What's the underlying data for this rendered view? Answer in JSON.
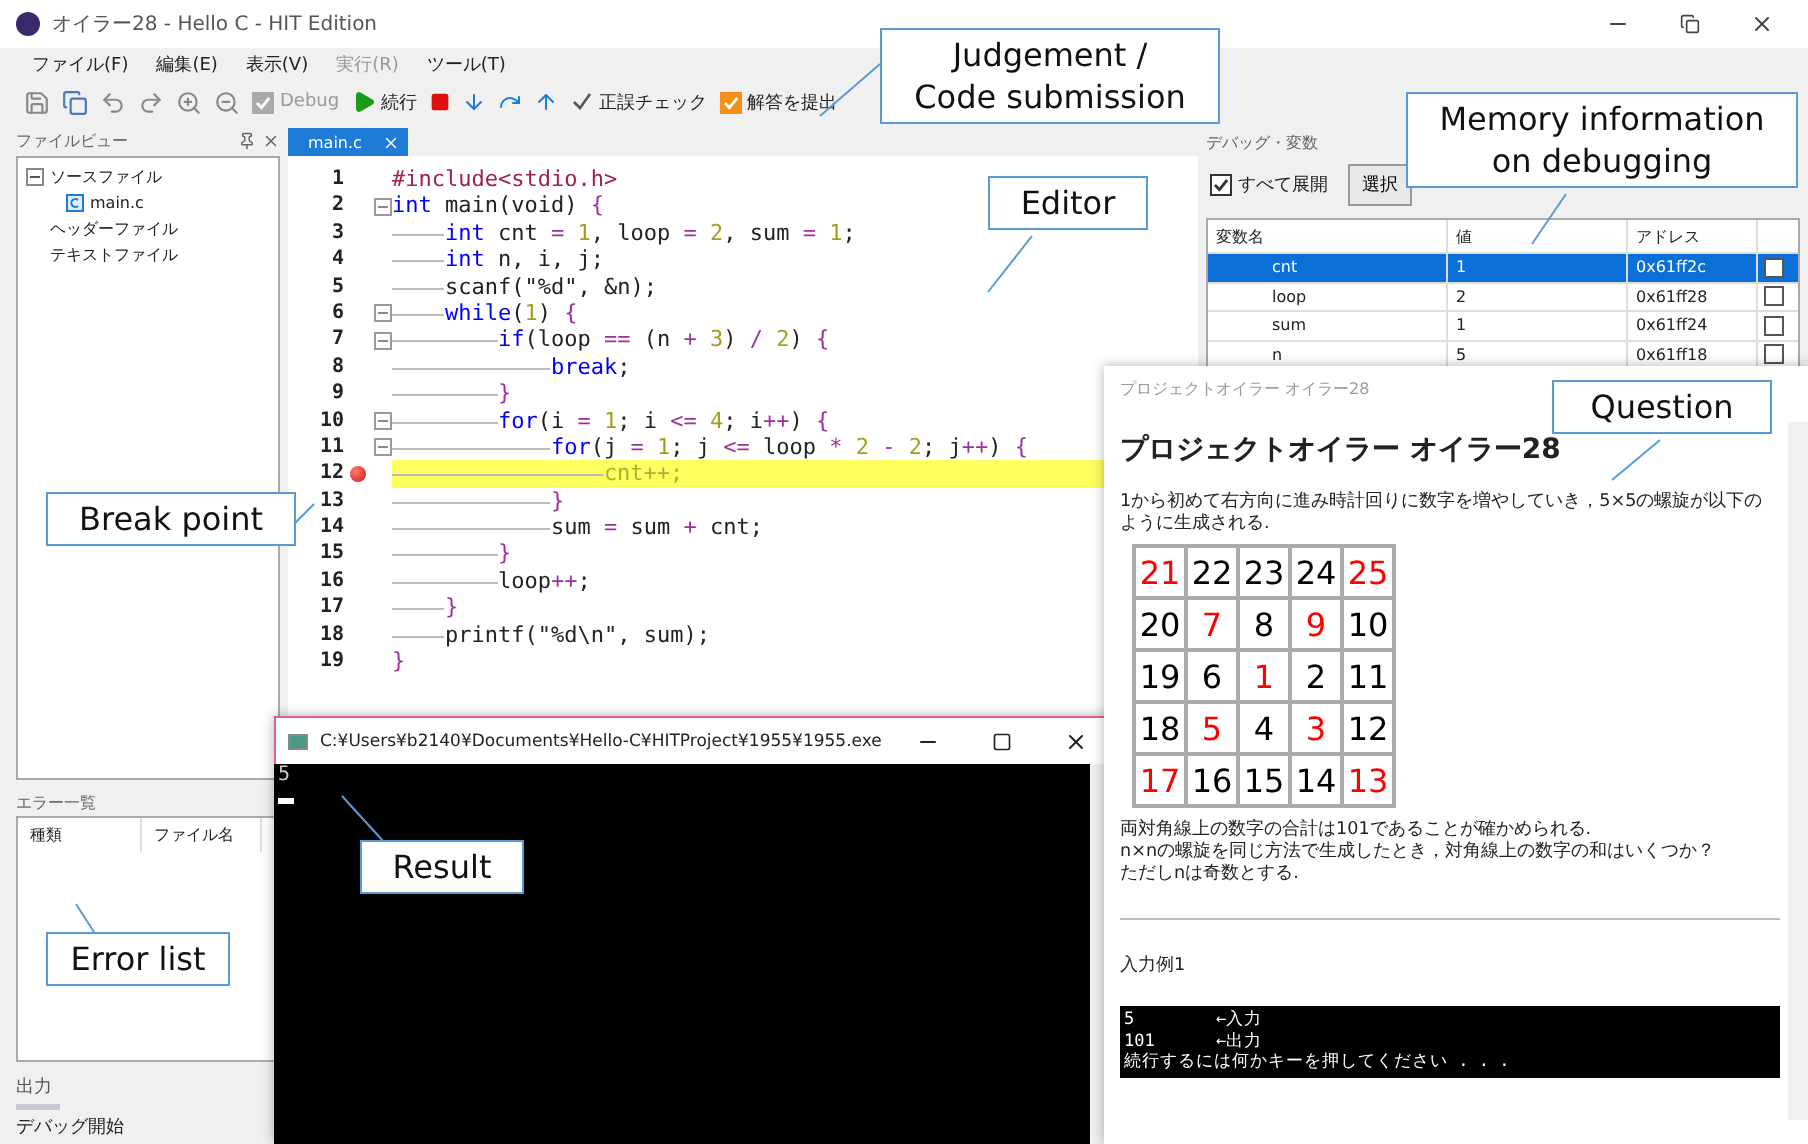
{
  "window": {
    "title": "オイラー28 - Hello C - HIT Edition"
  },
  "menu": [
    {
      "label": "ファイル(F)",
      "disabled": false
    },
    {
      "label": "編集(E)",
      "disabled": false
    },
    {
      "label": "表示(V)",
      "disabled": false
    },
    {
      "label": "実行(R)",
      "disabled": true
    },
    {
      "label": "ツール(T)",
      "disabled": false
    }
  ],
  "toolbar": {
    "debug": {
      "label": "Debug",
      "checked": true,
      "disabled": true
    },
    "continue": {
      "label": "続行"
    },
    "check": {
      "label": "正誤チェック"
    },
    "submit": {
      "label": "解答を提出",
      "checked": true
    }
  },
  "file_view": {
    "title": "ファイルビュー",
    "tree": [
      {
        "label": "ソースファイル",
        "expanded": true,
        "children": [
          {
            "label": "main.c"
          }
        ]
      },
      {
        "label": "ヘッダーファイル"
      },
      {
        "label": "テキストファイル"
      }
    ]
  },
  "error_list": {
    "title": "エラー一覧",
    "columns": [
      "種類",
      "ファイル名"
    ]
  },
  "output": {
    "title": "出力"
  },
  "status": "デバッグ開始",
  "editor": {
    "tab": "main.c",
    "lines": [
      {
        "num": "1",
        "fold": false,
        "breakpoint": false,
        "current": false,
        "tokens": [
          {
            "kind": "pp",
            "text": "#include<stdio.h>"
          }
        ]
      },
      {
        "num": "2",
        "fold": true,
        "breakpoint": false,
        "current": false,
        "tokens": [
          {
            "kind": "kw",
            "text": "int"
          },
          {
            "kind": "p",
            "text": " main(void) "
          },
          {
            "kind": "op",
            "text": "{"
          }
        ]
      },
      {
        "num": "3",
        "fold": false,
        "breakpoint": false,
        "current": false,
        "tokens": [
          {
            "kind": "kw",
            "text": "\tint"
          },
          {
            "kind": "p",
            "text": " cnt "
          },
          {
            "kind": "op",
            "text": "="
          },
          {
            "kind": "num",
            "text": " 1"
          },
          {
            "kind": "p",
            "text": ", loop "
          },
          {
            "kind": "op",
            "text": "="
          },
          {
            "kind": "num",
            "text": " 2"
          },
          {
            "kind": "p",
            "text": ", sum "
          },
          {
            "kind": "op",
            "text": "="
          },
          {
            "kind": "num",
            "text": " 1"
          },
          {
            "kind": "p",
            "text": ";"
          }
        ]
      },
      {
        "num": "4",
        "fold": false,
        "breakpoint": false,
        "current": false,
        "tokens": [
          {
            "kind": "kw",
            "text": "\tint"
          },
          {
            "kind": "p",
            "text": " n, i, j;"
          }
        ]
      },
      {
        "num": "5",
        "fold": false,
        "breakpoint": false,
        "current": false,
        "tokens": [
          {
            "kind": "p",
            "text": "\tscanf(\"%d\", &n);"
          }
        ]
      },
      {
        "num": "6",
        "fold": true,
        "breakpoint": false,
        "current": false,
        "tokens": [
          {
            "kind": "kw",
            "text": "\twhile"
          },
          {
            "kind": "p",
            "text": "("
          },
          {
            "kind": "num",
            "text": "1"
          },
          {
            "kind": "p",
            "text": ") "
          },
          {
            "kind": "op",
            "text": "{"
          }
        ]
      },
      {
        "num": "7",
        "fold": true,
        "breakpoint": false,
        "current": false,
        "tokens": [
          {
            "kind": "kw",
            "text": "\t\tif"
          },
          {
            "kind": "p",
            "text": "(loop "
          },
          {
            "kind": "op",
            "text": "=="
          },
          {
            "kind": "p",
            "text": " (n "
          },
          {
            "kind": "op",
            "text": "+"
          },
          {
            "kind": "num",
            "text": " 3"
          },
          {
            "kind": "p",
            "text": ") "
          },
          {
            "kind": "op",
            "text": "/"
          },
          {
            "kind": "num",
            "text": " 2"
          },
          {
            "kind": "p",
            "text": ") "
          },
          {
            "kind": "op",
            "text": "{"
          }
        ]
      },
      {
        "num": "8",
        "fold": false,
        "breakpoint": false,
        "current": false,
        "tokens": [
          {
            "kind": "kw",
            "text": "\t\t\tbreak"
          },
          {
            "kind": "p",
            "text": ";"
          }
        ]
      },
      {
        "num": "9",
        "fold": false,
        "breakpoint": false,
        "current": false,
        "tokens": [
          {
            "kind": "op",
            "text": "\t\t}"
          }
        ]
      },
      {
        "num": "10",
        "fold": true,
        "breakpoint": false,
        "current": false,
        "tokens": [
          {
            "kind": "kw",
            "text": "\t\tfor"
          },
          {
            "kind": "p",
            "text": "(i "
          },
          {
            "kind": "op",
            "text": "="
          },
          {
            "kind": "num",
            "text": " 1"
          },
          {
            "kind": "p",
            "text": "; i "
          },
          {
            "kind": "op",
            "text": "<="
          },
          {
            "kind": "num",
            "text": " 4"
          },
          {
            "kind": "p",
            "text": "; i"
          },
          {
            "kind": "op",
            "text": "++"
          },
          {
            "kind": "p",
            "text": ") "
          },
          {
            "kind": "op",
            "text": "{"
          }
        ]
      },
      {
        "num": "11",
        "fold": true,
        "breakpoint": false,
        "current": false,
        "tokens": [
          {
            "kind": "kw",
            "text": "\t\t\tfor"
          },
          {
            "kind": "p",
            "text": "(j "
          },
          {
            "kind": "op",
            "text": "="
          },
          {
            "kind": "num",
            "text": " 1"
          },
          {
            "kind": "p",
            "text": "; j "
          },
          {
            "kind": "op",
            "text": "<="
          },
          {
            "kind": "p",
            "text": " loop "
          },
          {
            "kind": "op",
            "text": "*"
          },
          {
            "kind": "num",
            "text": " 2"
          },
          {
            "kind": "op",
            "text": " -"
          },
          {
            "kind": "num",
            "text": " 2"
          },
          {
            "kind": "p",
            "text": "; j"
          },
          {
            "kind": "op",
            "text": "++"
          },
          {
            "kind": "p",
            "text": ") "
          },
          {
            "kind": "op",
            "text": "{"
          }
        ]
      },
      {
        "num": "12",
        "fold": false,
        "breakpoint": true,
        "current": true,
        "tokens": [
          {
            "kind": "p",
            "text": "\t\t\t\tcnt++;"
          }
        ]
      },
      {
        "num": "13",
        "fold": false,
        "breakpoint": false,
        "current": false,
        "tokens": [
          {
            "kind": "op",
            "text": "\t\t\t}"
          }
        ]
      },
      {
        "num": "14",
        "fold": false,
        "breakpoint": false,
        "current": false,
        "tokens": [
          {
            "kind": "p",
            "text": "\t\t\tsum "
          },
          {
            "kind": "op",
            "text": "="
          },
          {
            "kind": "p",
            "text": " sum "
          },
          {
            "kind": "op",
            "text": "+"
          },
          {
            "kind": "p",
            "text": " cnt;"
          }
        ]
      },
      {
        "num": "15",
        "fold": false,
        "breakpoint": false,
        "current": false,
        "tokens": [
          {
            "kind": "op",
            "text": "\t\t}"
          }
        ]
      },
      {
        "num": "16",
        "fold": false,
        "breakpoint": false,
        "current": false,
        "tokens": [
          {
            "kind": "p",
            "text": "\t\tloop"
          },
          {
            "kind": "op",
            "text": "++"
          },
          {
            "kind": "p",
            "text": ";"
          }
        ]
      },
      {
        "num": "17",
        "fold": false,
        "breakpoint": false,
        "current": false,
        "tokens": [
          {
            "kind": "op",
            "text": "\t}"
          }
        ]
      },
      {
        "num": "18",
        "fold": false,
        "breakpoint": false,
        "current": false,
        "tokens": [
          {
            "kind": "p",
            "text": "\tprintf(\"%d\\n\", sum);"
          }
        ]
      },
      {
        "num": "19",
        "fold": false,
        "breakpoint": false,
        "current": false,
        "tokens": [
          {
            "kind": "op",
            "text": "}"
          }
        ]
      }
    ]
  },
  "debug": {
    "title": "デバッグ・変数",
    "expand_all": {
      "label": "すべて展開",
      "checked": true
    },
    "button": "選択",
    "columns": [
      "変数名",
      "値",
      "アドレス"
    ],
    "rows": [
      {
        "name": "cnt",
        "value": "1",
        "address": "0x61ff2c",
        "selected": true,
        "checked": false
      },
      {
        "name": "loop",
        "value": "2",
        "address": "0x61ff28",
        "selected": false,
        "checked": false
      },
      {
        "name": "sum",
        "value": "1",
        "address": "0x61ff24",
        "selected": false,
        "checked": false
      },
      {
        "name": "n",
        "value": "5",
        "address": "0x61ff18",
        "selected": false,
        "checked": false
      }
    ]
  },
  "console": {
    "title": "C:¥Users¥b2140¥Documents¥Hello-C¥HITProject¥1955¥1955.exe",
    "output": "5"
  },
  "question": {
    "window_title": "プロジェクトオイラー オイラー28",
    "heading": "プロジェクトオイラー オイラー28",
    "intro": "1から初めて右方向に進み時計回りに数字を増やしていき，5×5の螺旋が以下のように生成される.",
    "grid": [
      [
        {
          "v": "21",
          "color": "#ff0000"
        },
        {
          "v": "22",
          "color": "#000000"
        },
        {
          "v": "23",
          "color": "#000000"
        },
        {
          "v": "24",
          "color": "#000000"
        },
        {
          "v": "25",
          "color": "#ff0000"
        }
      ],
      [
        {
          "v": "20",
          "color": "#000000"
        },
        {
          "v": "7",
          "color": "#ff0000"
        },
        {
          "v": "8",
          "color": "#000000"
        },
        {
          "v": "9",
          "color": "#ff0000"
        },
        {
          "v": "10",
          "color": "#000000"
        }
      ],
      [
        {
          "v": "19",
          "color": "#000000"
        },
        {
          "v": "6",
          "color": "#000000"
        },
        {
          "v": "1",
          "color": "#ff0000"
        },
        {
          "v": "2",
          "color": "#000000"
        },
        {
          "v": "11",
          "color": "#000000"
        }
      ],
      [
        {
          "v": "18",
          "color": "#000000"
        },
        {
          "v": "5",
          "color": "#ff0000"
        },
        {
          "v": "4",
          "color": "#000000"
        },
        {
          "v": "3",
          "color": "#ff0000"
        },
        {
          "v": "12",
          "color": "#000000"
        }
      ],
      [
        {
          "v": "17",
          "color": "#ff0000"
        },
        {
          "v": "16",
          "color": "#000000"
        },
        {
          "v": "15",
          "color": "#000000"
        },
        {
          "v": "14",
          "color": "#000000"
        },
        {
          "v": "13",
          "color": "#ff0000"
        }
      ]
    ],
    "body": [
      "両対角線上の数字の合計は101であることが確かめられる.",
      "n×nの螺旋を同じ方法で生成したとき，対角線上の数字の和はいくつか？",
      "ただしnは奇数とする."
    ],
    "example_title": "入力例1",
    "example_lines": [
      "5        ←入力",
      "101      ←出力",
      "続行するには何かキーを押してください . . ."
    ]
  },
  "callouts": {
    "judgement": [
      "Judgement /",
      "Code submission"
    ],
    "memory": [
      "Memory information",
      "on debugging"
    ],
    "editor": [
      "Editor"
    ],
    "question": [
      "Question"
    ],
    "breakpoint": [
      "Break point"
    ],
    "result": [
      "Result"
    ],
    "error_list": [
      "Error list"
    ]
  }
}
